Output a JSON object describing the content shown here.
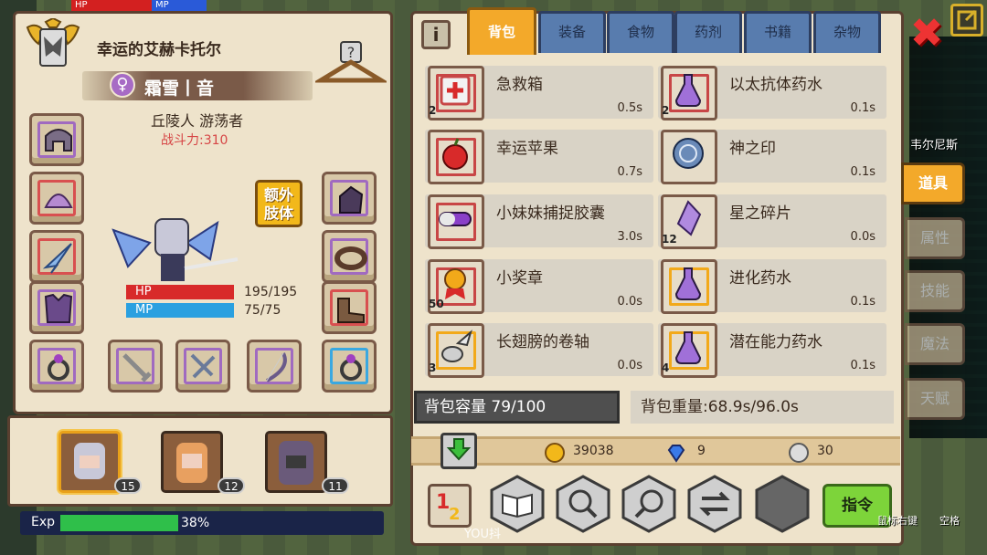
{
  "hud": {
    "hp_short": "HP",
    "mp_short": "MP"
  },
  "hero": {
    "name": "幸运的艾赫卡托尔",
    "gender_symbol": "♀",
    "subname": "霜雪丨音",
    "race_class": "丘陵人 游荡者",
    "power": "战斗力:310",
    "extra_limb_label": "额外\n肢体",
    "hp_label": "HP",
    "hp_value": "195/195",
    "hp_fraction": 1.0,
    "mp_label": "MP",
    "mp_value": "75/75",
    "mp_fraction": 1.0
  },
  "party": [
    {
      "level": "15",
      "selected": true
    },
    {
      "level": "12",
      "selected": false
    },
    {
      "level": "11",
      "selected": false
    }
  ],
  "exp": {
    "label": "Exp",
    "percent": "38%",
    "fraction": 0.38
  },
  "tabs": [
    {
      "label": "背包",
      "active": true
    },
    {
      "label": "装备",
      "active": false
    },
    {
      "label": "食物",
      "active": false
    },
    {
      "label": "药剂",
      "active": false
    },
    {
      "label": "书籍",
      "active": false
    },
    {
      "label": "杂物",
      "active": false
    }
  ],
  "items": [
    {
      "name": "急救箱",
      "qty": "2",
      "time": "0.5s",
      "icon": "first-aid-kit-icon"
    },
    {
      "name": "以太抗体药水",
      "qty": "2",
      "time": "0.1s",
      "icon": "potion-icon"
    },
    {
      "name": "幸运苹果",
      "qty": "",
      "time": "0.7s",
      "icon": "apple-icon"
    },
    {
      "name": "神之印",
      "qty": "",
      "time": "0.1s",
      "icon": "seal-icon"
    },
    {
      "name": "小妹妹捕捉胶囊",
      "qty": "",
      "time": "3.0s",
      "icon": "capsule-icon"
    },
    {
      "name": "星之碎片",
      "qty": "12",
      "time": "0.0s",
      "icon": "crystal-icon"
    },
    {
      "name": "小奖章",
      "qty": "50",
      "time": "0.0s",
      "icon": "medal-icon"
    },
    {
      "name": "进化药水",
      "qty": "",
      "time": "0.1s",
      "icon": "potion-icon"
    },
    {
      "name": "长翅膀的卷轴",
      "qty": "3",
      "time": "0.0s",
      "icon": "winged-scroll-icon"
    },
    {
      "name": "潜在能力药水",
      "qty": "4",
      "time": "0.1s",
      "icon": "potion-icon"
    }
  ],
  "bag": {
    "capacity": "背包容量 79/100",
    "weight": "背包重量:68.9s/96.0s"
  },
  "currency": {
    "gold": "39038",
    "gems": "9",
    "silver": "30"
  },
  "command_label": "指令",
  "side_tabs": [
    {
      "label": "道具",
      "active": true
    },
    {
      "label": "属性",
      "active": false
    },
    {
      "label": "技能",
      "active": false
    },
    {
      "label": "魔法",
      "active": false
    },
    {
      "label": "天赋",
      "active": false
    }
  ],
  "map_label": "韦尔尼斯",
  "hints": {
    "right_click": "鼠标右键",
    "space": "空格"
  },
  "watermark": "YOU抖"
}
